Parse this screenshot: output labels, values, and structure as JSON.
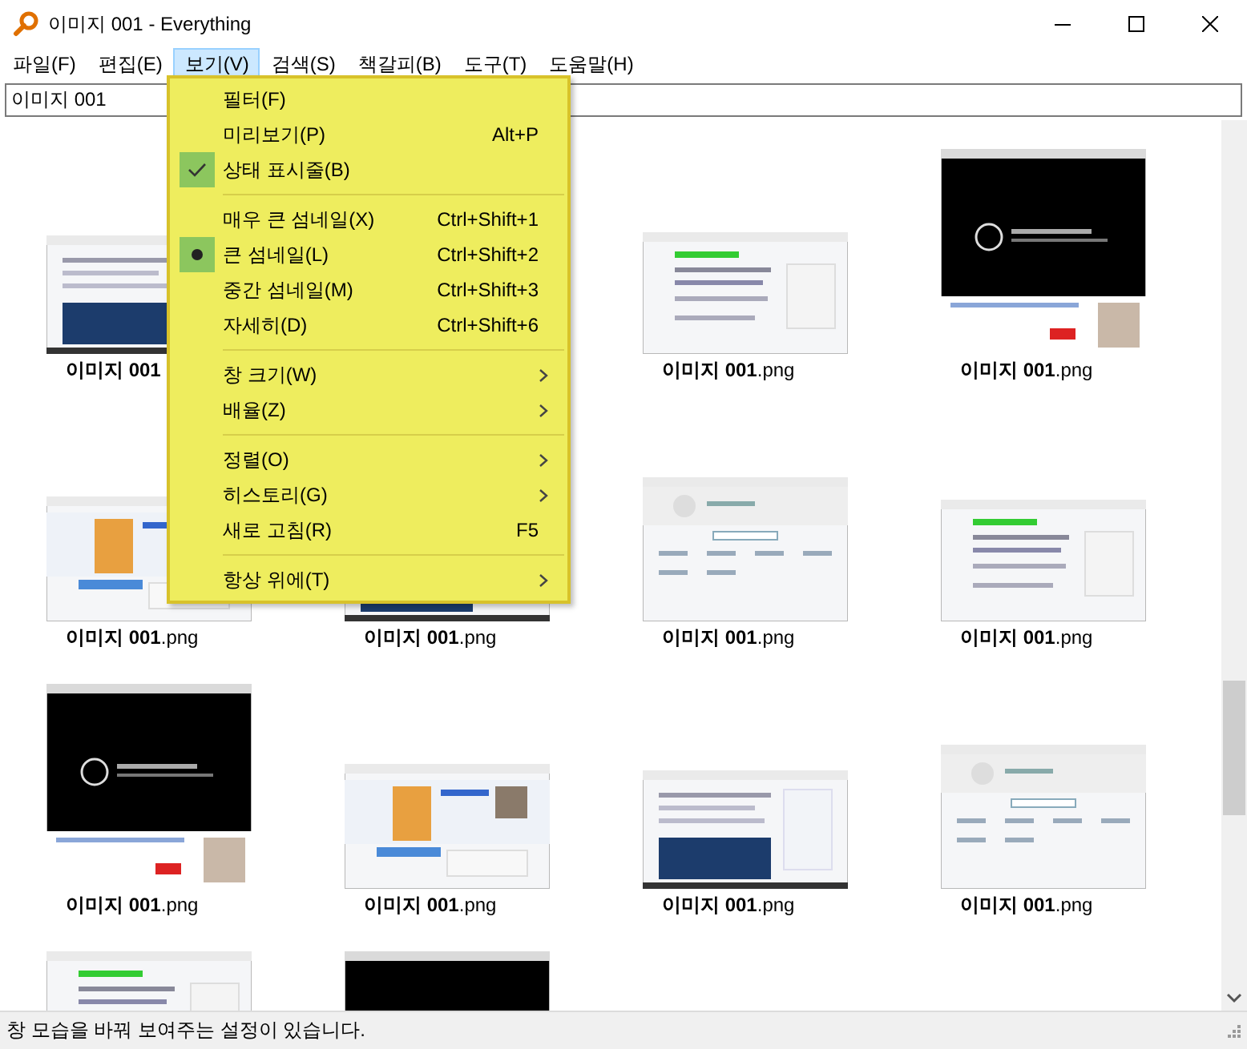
{
  "window": {
    "title": "이미지 001 - Everything"
  },
  "menubar": [
    {
      "label": "파일(F)",
      "selected": false
    },
    {
      "label": "편집(E)",
      "selected": false
    },
    {
      "label": "보기(V)",
      "selected": true
    },
    {
      "label": "검색(S)",
      "selected": false
    },
    {
      "label": "책갈피(B)",
      "selected": false
    },
    {
      "label": "도구(T)",
      "selected": false
    },
    {
      "label": "도움말(H)",
      "selected": false
    }
  ],
  "search": {
    "value": "이미지 001"
  },
  "results": [
    {
      "kind": "picture",
      "label": "**이미지 001**"
    },
    {
      "kind": "empty"
    },
    {
      "kind": "picture",
      "label": "**이미지 001**.png"
    },
    {
      "kind": "picture",
      "label": "**이미지 001**.png"
    },
    {
      "kind": "picture",
      "label": "**이미지 001**.png"
    },
    {
      "kind": "picture",
      "label": "**이미지 001**.png"
    },
    {
      "kind": "picture",
      "label": "**이미지 001**.png"
    },
    {
      "kind": "picture",
      "label": "**이미지 001**.png"
    },
    {
      "kind": "picture",
      "label": "**이미지 001**.png"
    },
    {
      "kind": "picture",
      "label": "**이미지 001**.png"
    },
    {
      "kind": "picture",
      "label": "**이미지 001**.png"
    },
    {
      "kind": "picture",
      "label": "**이미지 001**.png"
    },
    {
      "kind": "picture"
    },
    {
      "kind": "picture"
    }
  ],
  "view_menu": [
    {
      "kind": "check",
      "label": "필터(F)",
      "checked": false
    },
    {
      "kind": "check",
      "label": "미리보기(P)",
      "shortcut": "Alt+P",
      "checked": false
    },
    {
      "kind": "check",
      "label": "상태 표시줄(B)",
      "checked": true
    },
    {
      "kind": "separator"
    },
    {
      "kind": "radio",
      "label": "매우 큰 섬네일(X)",
      "shortcut": "Ctrl+Shift+1",
      "selected": false
    },
    {
      "kind": "radio",
      "label": "큰 섬네일(L)",
      "shortcut": "Ctrl+Shift+2",
      "selected": true
    },
    {
      "kind": "radio",
      "label": "중간 섬네일(M)",
      "shortcut": "Ctrl+Shift+3",
      "selected": false
    },
    {
      "kind": "radio",
      "label": "자세히(D)",
      "shortcut": "Ctrl+Shift+6",
      "selected": false
    },
    {
      "kind": "separator"
    },
    {
      "kind": "submenu",
      "label": "창 크기(W)"
    },
    {
      "kind": "submenu",
      "label": "배율(Z)"
    },
    {
      "kind": "separator"
    },
    {
      "kind": "submenu",
      "label": "정렬(O)"
    },
    {
      "kind": "submenu",
      "label": "히스토리(G)"
    },
    {
      "kind": "item",
      "label": "새로 고침(R)",
      "shortcut": "F5"
    },
    {
      "kind": "separator"
    },
    {
      "kind": "submenu",
      "label": "항상 위에(T)"
    }
  ],
  "status_bar": {
    "text": "창 모습을 바꿔 보여주는 설정이 있습니다."
  }
}
